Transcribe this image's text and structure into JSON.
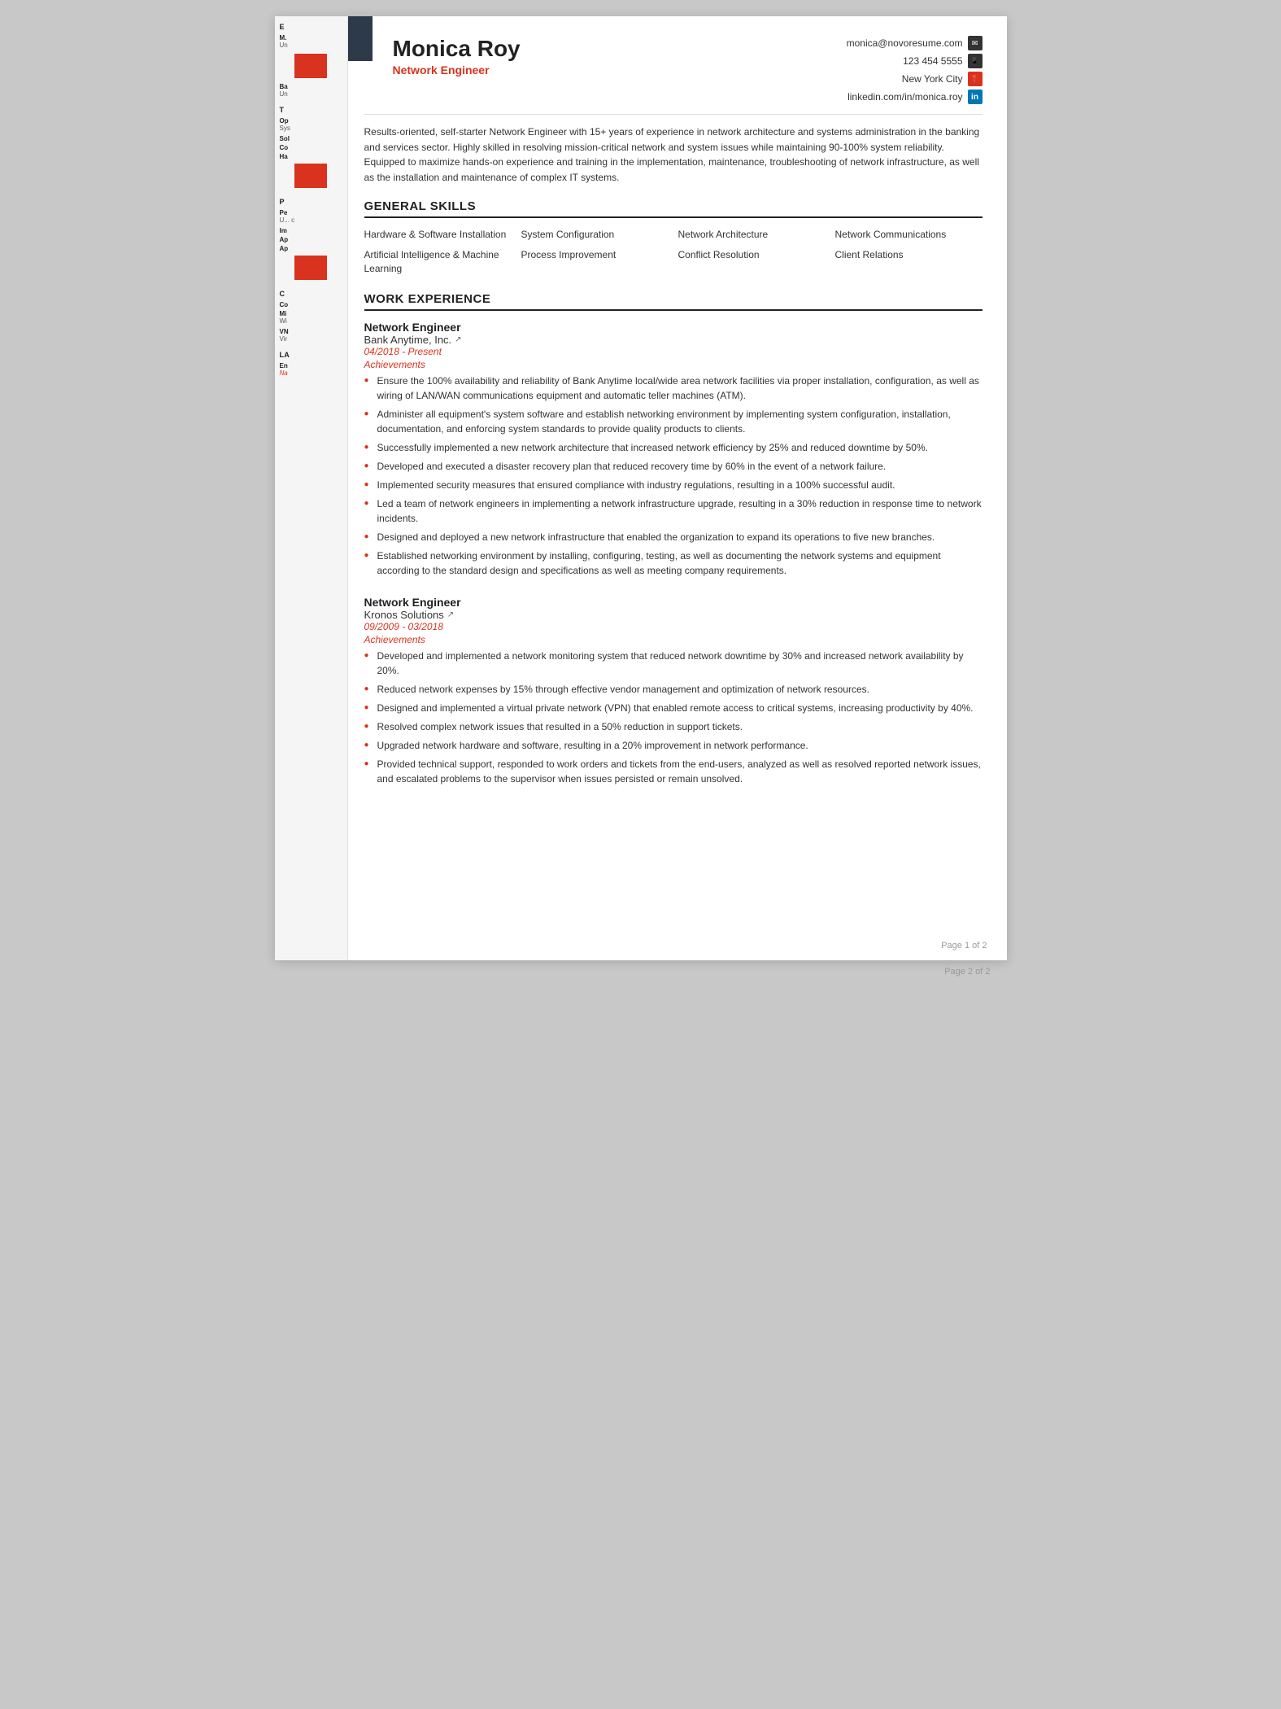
{
  "page1": {
    "page_number": "Page 1 of 2",
    "header": {
      "name": "Monica Roy",
      "title": "Network Engineer",
      "contact": {
        "email": "monica@novoresume.com",
        "phone": "123 454 5555",
        "location": "New York City",
        "linkedin": "linkedin.com/in/monica.roy"
      }
    },
    "summary": "Results-oriented, self-starter Network Engineer with 15+ years of experience in network architecture and systems administration in the banking and services sector. Highly skilled in resolving mission-critical network and system issues while maintaining 90-100% system reliability. Equipped to maximize hands-on experience and training in the implementation, maintenance, troubleshooting of network infrastructure, as well as the installation and maintenance of complex IT systems.",
    "general_skills": {
      "section_title": "GENERAL SKILLS",
      "skills": [
        "Hardware & Software Installation",
        "System Configuration",
        "Network Architecture",
        "Network Communications",
        "Artificial Intelligence & Machine Learning",
        "Process Improvement",
        "Conflict Resolution",
        "Client Relations"
      ]
    },
    "work_experience": {
      "section_title": "WORK EXPERIENCE",
      "jobs": [
        {
          "title": "Network Engineer",
          "company": "Bank Anytime, Inc.",
          "company_link": true,
          "dates": "04/2018 - Present",
          "achievements_label": "Achievements",
          "achievements": [
            "Ensure the 100% availability and reliability of Bank Anytime local/wide area network facilities via proper installation, configuration, as well as wiring of LAN/WAN communications equipment and automatic teller machines (ATM).",
            "Administer all equipment's system software and establish networking environment by implementing system configuration, installation, documentation, and enforcing system standards to provide quality products to clients.",
            "Successfully implemented a new network architecture that increased network efficiency by 25% and reduced downtime by 50%.",
            "Developed and executed a disaster recovery plan that reduced recovery time by 60% in the event of a network failure.",
            "Implemented security measures that ensured compliance with industry regulations, resulting in a 100% successful audit.",
            "Led a team of network engineers in implementing a network infrastructure upgrade, resulting in a 30% reduction in response time to network incidents.",
            "Designed and deployed a new network infrastructure that enabled the organization to expand its operations to five new branches.",
            "Established networking environment by installing, configuring, testing, as well as documenting the network systems and equipment according to the standard design and specifications as well as meeting company requirements."
          ]
        },
        {
          "title": "Network Engineer",
          "company": "Kronos Solutions",
          "company_link": true,
          "dates": "09/2009 - 03/2018",
          "achievements_label": "Achievements",
          "achievements": [
            "Developed and implemented a network monitoring system that reduced network downtime by 30% and increased network availability by 20%.",
            "Reduced network expenses by 15% through effective vendor management and optimization of network resources.",
            "Designed and implemented a virtual private network (VPN) that enabled remote access to critical systems, increasing productivity by 40%.",
            "Resolved complex network issues that resulted in a 50% reduction in support tickets.",
            "Upgraded network hardware and software, resulting in a 20% improvement in network performance.",
            "Provided technical support, responded to work orders and tickets from the end-users, analyzed as well as resolved reported network issues, and escalated problems to the supervisor when issues persisted or remain unsolved."
          ]
        }
      ]
    }
  },
  "sidebar": {
    "sections": [
      {
        "label": "E",
        "items": [
          {
            "bold": "M.",
            "normal": "Un"
          },
          {
            "red_bar": true
          },
          {
            "bold": "Ba",
            "normal": "Un"
          }
        ]
      },
      {
        "label": "T",
        "items": [
          {
            "bold": "Op",
            "normal": "Sys"
          },
          {
            "bold": "Sol"
          },
          {
            "bold": "Co"
          },
          {
            "bold": "Ha",
            "red_bar": true
          }
        ]
      },
      {
        "label": "P",
        "items": [
          {
            "bold": "Pe",
            "normal": "U...c"
          },
          {
            "bold": "Im",
            "normal": ""
          },
          {
            "bold": "Ap"
          },
          {
            "bold": "Ap",
            "red_bar": true
          }
        ]
      },
      {
        "label": "C",
        "items": [
          {
            "bold": "Co"
          },
          {
            "bold": "Mi",
            "normal": "Wi"
          },
          {
            "bold": "VN",
            "normal": "Vir"
          }
        ]
      },
      {
        "label": "LA",
        "items": [
          {
            "bold": "En"
          },
          {
            "red": "Na"
          }
        ]
      }
    ]
  },
  "page2": {
    "page_number": "Page 2 of 2"
  }
}
